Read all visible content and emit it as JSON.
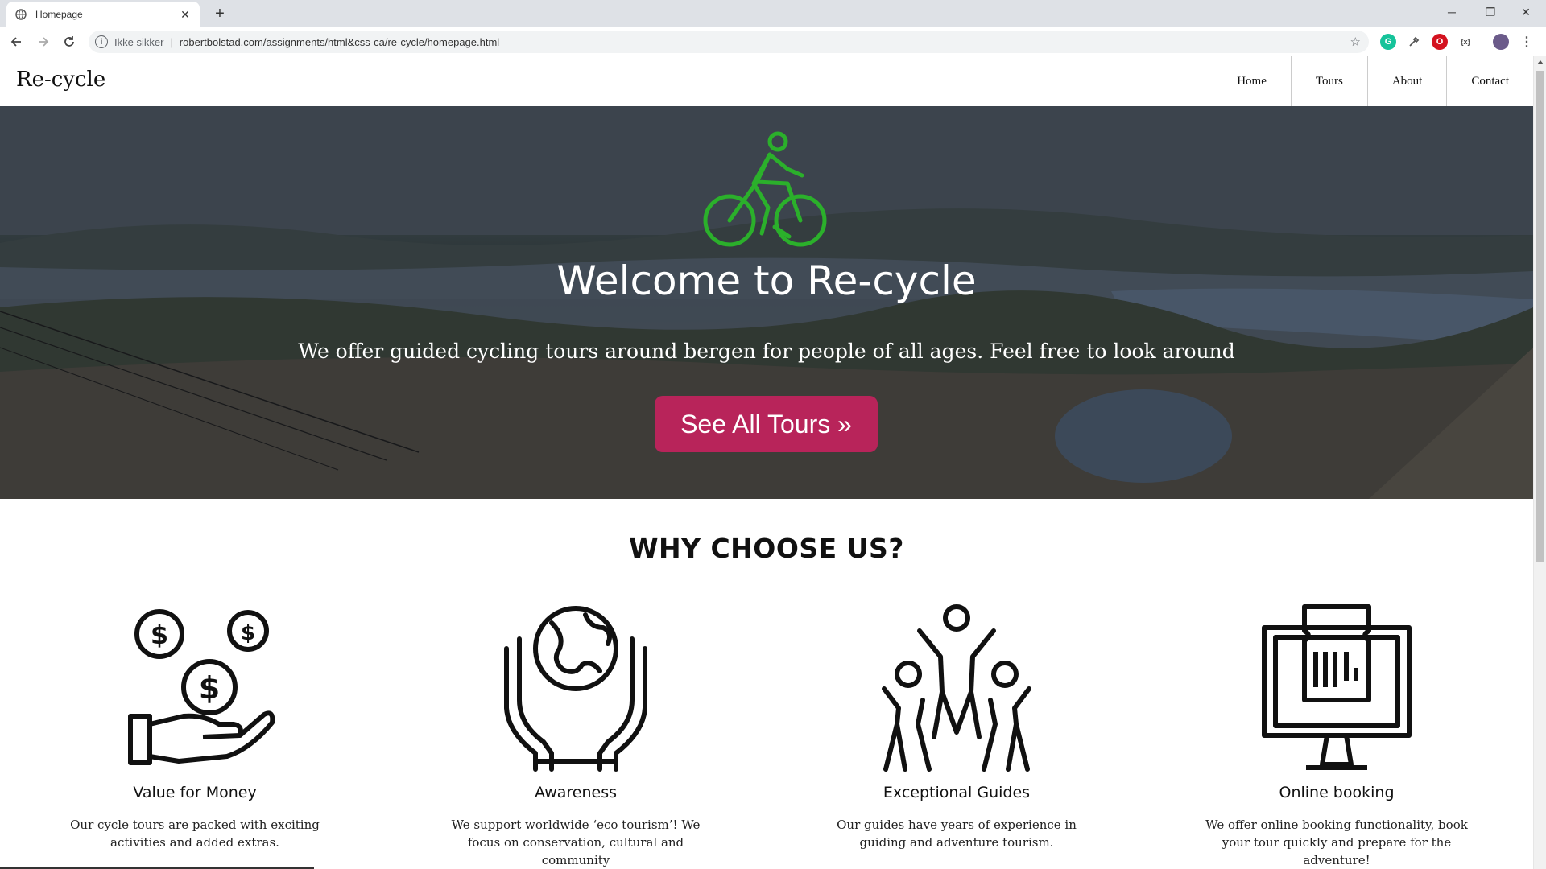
{
  "browser": {
    "tab_title": "Homepage",
    "tab_close": "✕",
    "new_tab": "+",
    "security_label": "Ikke sikker",
    "url": "robertbolstad.com/assignments/html&css-ca/re-cycle/homepage.html",
    "window_minimize": "─",
    "window_restore": "❐",
    "window_close": "✕"
  },
  "site": {
    "logo": "Re-cycle",
    "nav": [
      "Home",
      "Tours",
      "About",
      "Contact"
    ]
  },
  "hero": {
    "title": "Welcome to Re-cycle",
    "subtitle": "We offer guided cycling tours around bergen for people of all ages. Feel free to look around",
    "button": "See All Tours »",
    "accent_color": "#b8245a",
    "icon_color": "#2bb02b"
  },
  "why": {
    "title": "WHY CHOOSE US?",
    "features": [
      {
        "title": "Value for Money",
        "text": "Our cycle tours are packed with exciting activities and added extras.",
        "icon": "money-hand-icon"
      },
      {
        "title": "Awareness",
        "text": "We support worldwide ‘eco tourism’! We focus on conservation, cultural and community",
        "icon": "globe-hands-icon"
      },
      {
        "title": "Exceptional Guides",
        "text": "Our guides have years of experience in guiding and adventure tourism.",
        "icon": "people-group-icon"
      },
      {
        "title": "Online booking",
        "text": "We offer online booking functionality, book your tour quickly and prepare for the adventure!",
        "icon": "ticket-monitor-icon"
      }
    ]
  }
}
